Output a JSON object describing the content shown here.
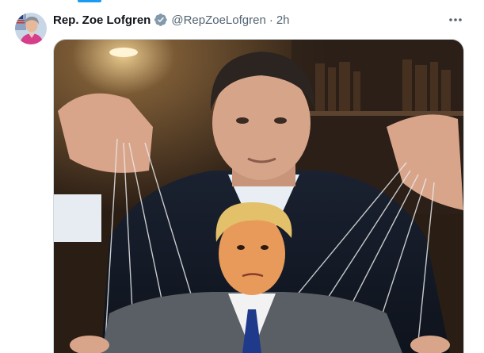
{
  "tweet": {
    "author_name": "Rep. Zoe Lofgren",
    "handle": "@RepZoeLofgren",
    "separator": "·",
    "time": "2h",
    "verified_color": "#829aab",
    "more_icon": "more-horizontal-icon",
    "avatar_icon": "avatar-portrait",
    "media": {
      "description_icon": "photo-media"
    }
  },
  "colors": {
    "accent": "#1d9bf0",
    "text_primary": "#0f1419",
    "text_secondary": "#536471",
    "border": "#cfd9de"
  }
}
